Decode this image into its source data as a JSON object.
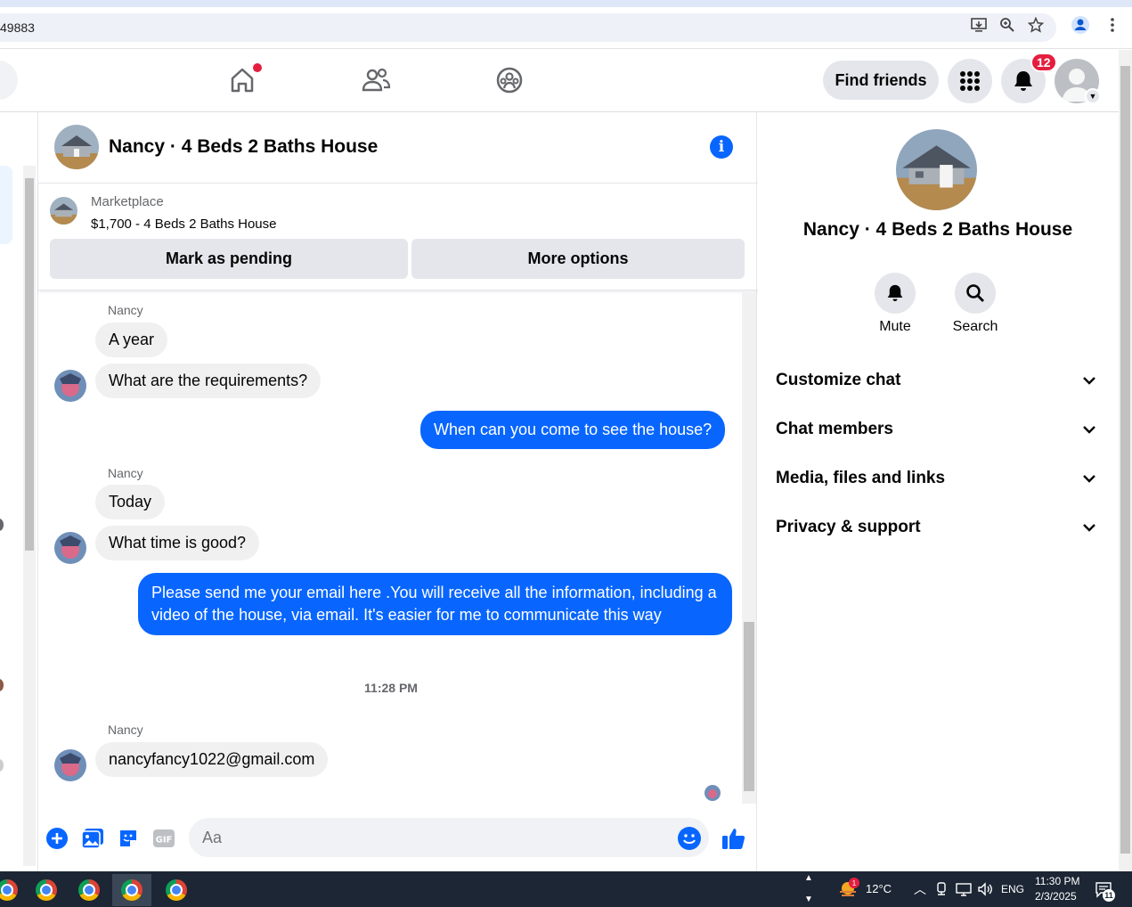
{
  "browser": {
    "url_fragment": "49883"
  },
  "nav": {
    "find_friends": "Find friends",
    "notif_count": "12"
  },
  "chat": {
    "title": "Nancy · 4 Beds 2 Baths House",
    "marketplace_label": "Marketplace",
    "listing": "$1,700 - 4 Beds 2 Baths House",
    "mark_pending": "Mark as pending",
    "more_options": "More options",
    "messages": {
      "sender1": "Nancy",
      "m1": "A year",
      "m2": "What are the requirements?",
      "m3": "When can you come to see the house?",
      "sender2": "Nancy",
      "m4": "Today",
      "m5": "What time is good?",
      "m6": "Please send me your email here .You will receive all the information, including a video of the house, via email. It's easier for me to communicate this way",
      "timestamp": "11:28 PM",
      "sender3": "Nancy",
      "m7": "nancyfancy1022@gmail.com"
    },
    "input_placeholder": "Aa"
  },
  "right_panel": {
    "title": "Nancy · 4 Beds 2 Baths House",
    "mute": "Mute",
    "search": "Search",
    "sections": [
      "Customize chat",
      "Chat members",
      "Media, files and links",
      "Privacy & support"
    ]
  },
  "taskbar": {
    "weather_temp": "12°C",
    "weather_badge": "1",
    "language": "ENG",
    "time": "11:30 PM",
    "date": "2/3/2025",
    "notif_count": "11"
  },
  "colors": {
    "accent": "#0866ff",
    "badge": "#e41e3f"
  }
}
